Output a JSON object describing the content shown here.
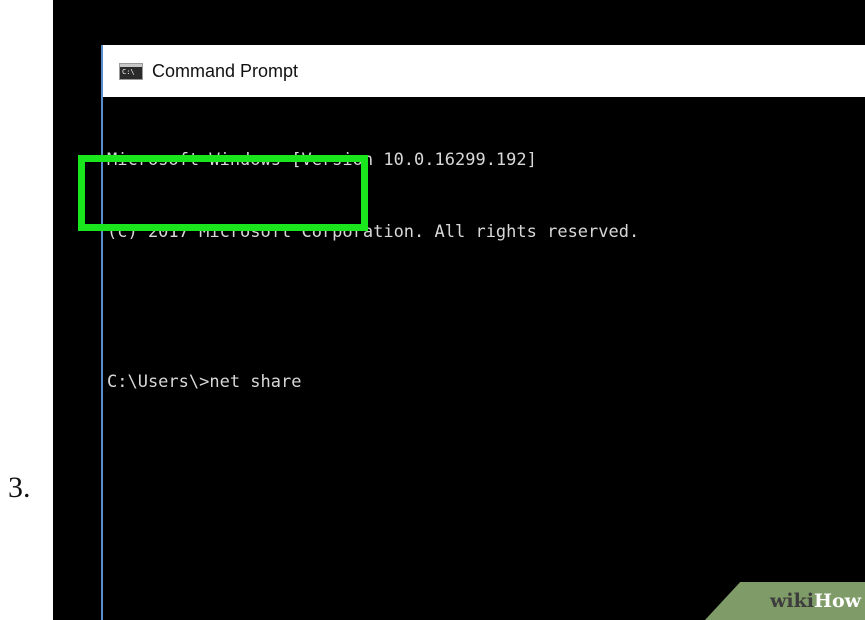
{
  "step": {
    "number": "3."
  },
  "window": {
    "title": "Command Prompt",
    "icon": "cmd-icon"
  },
  "console": {
    "lines": [
      "Microsoft Windows [Version 10.0.16299.192]",
      "(c) 2017 Microsoft Corporation. All rights reserved.",
      "C:\\Users\\>net share"
    ]
  },
  "highlight": {
    "color": "#19e61c"
  },
  "watermark": {
    "part1": "wiki",
    "part2": "How"
  },
  "colors": {
    "console_background": "#000000",
    "console_text": "#d8d8d8",
    "window_border": "#5b8ccf",
    "watermark_background": "#7f9b67"
  }
}
